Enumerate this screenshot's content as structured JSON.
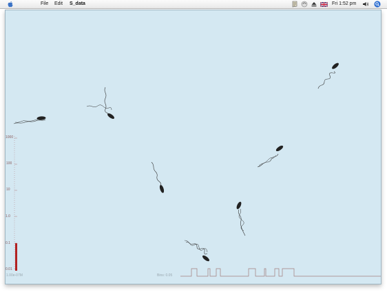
{
  "menubar": {
    "apple_icon": "apple-icon",
    "file_label": "File",
    "edit_label": "Edit",
    "app_name": "S_data",
    "status_icons": [
      "script-icon",
      "sync-icon",
      "eject-icon",
      "uk-flag-icon",
      "volume-icon",
      "spotlight-icon"
    ],
    "clock": "Fri 1:52 pm"
  },
  "scale": {
    "labels": [
      "1000",
      "100",
      "10",
      "1.0",
      "0.1",
      "0.01"
    ],
    "level_color": "#b22222",
    "readout": "1.00e-07M"
  },
  "timeline": {
    "label": "Bins: 0.05"
  },
  "colors": {
    "background": "#d4e8f2",
    "bacterium": "#222222",
    "scale_ticks": "#b07a7a"
  }
}
